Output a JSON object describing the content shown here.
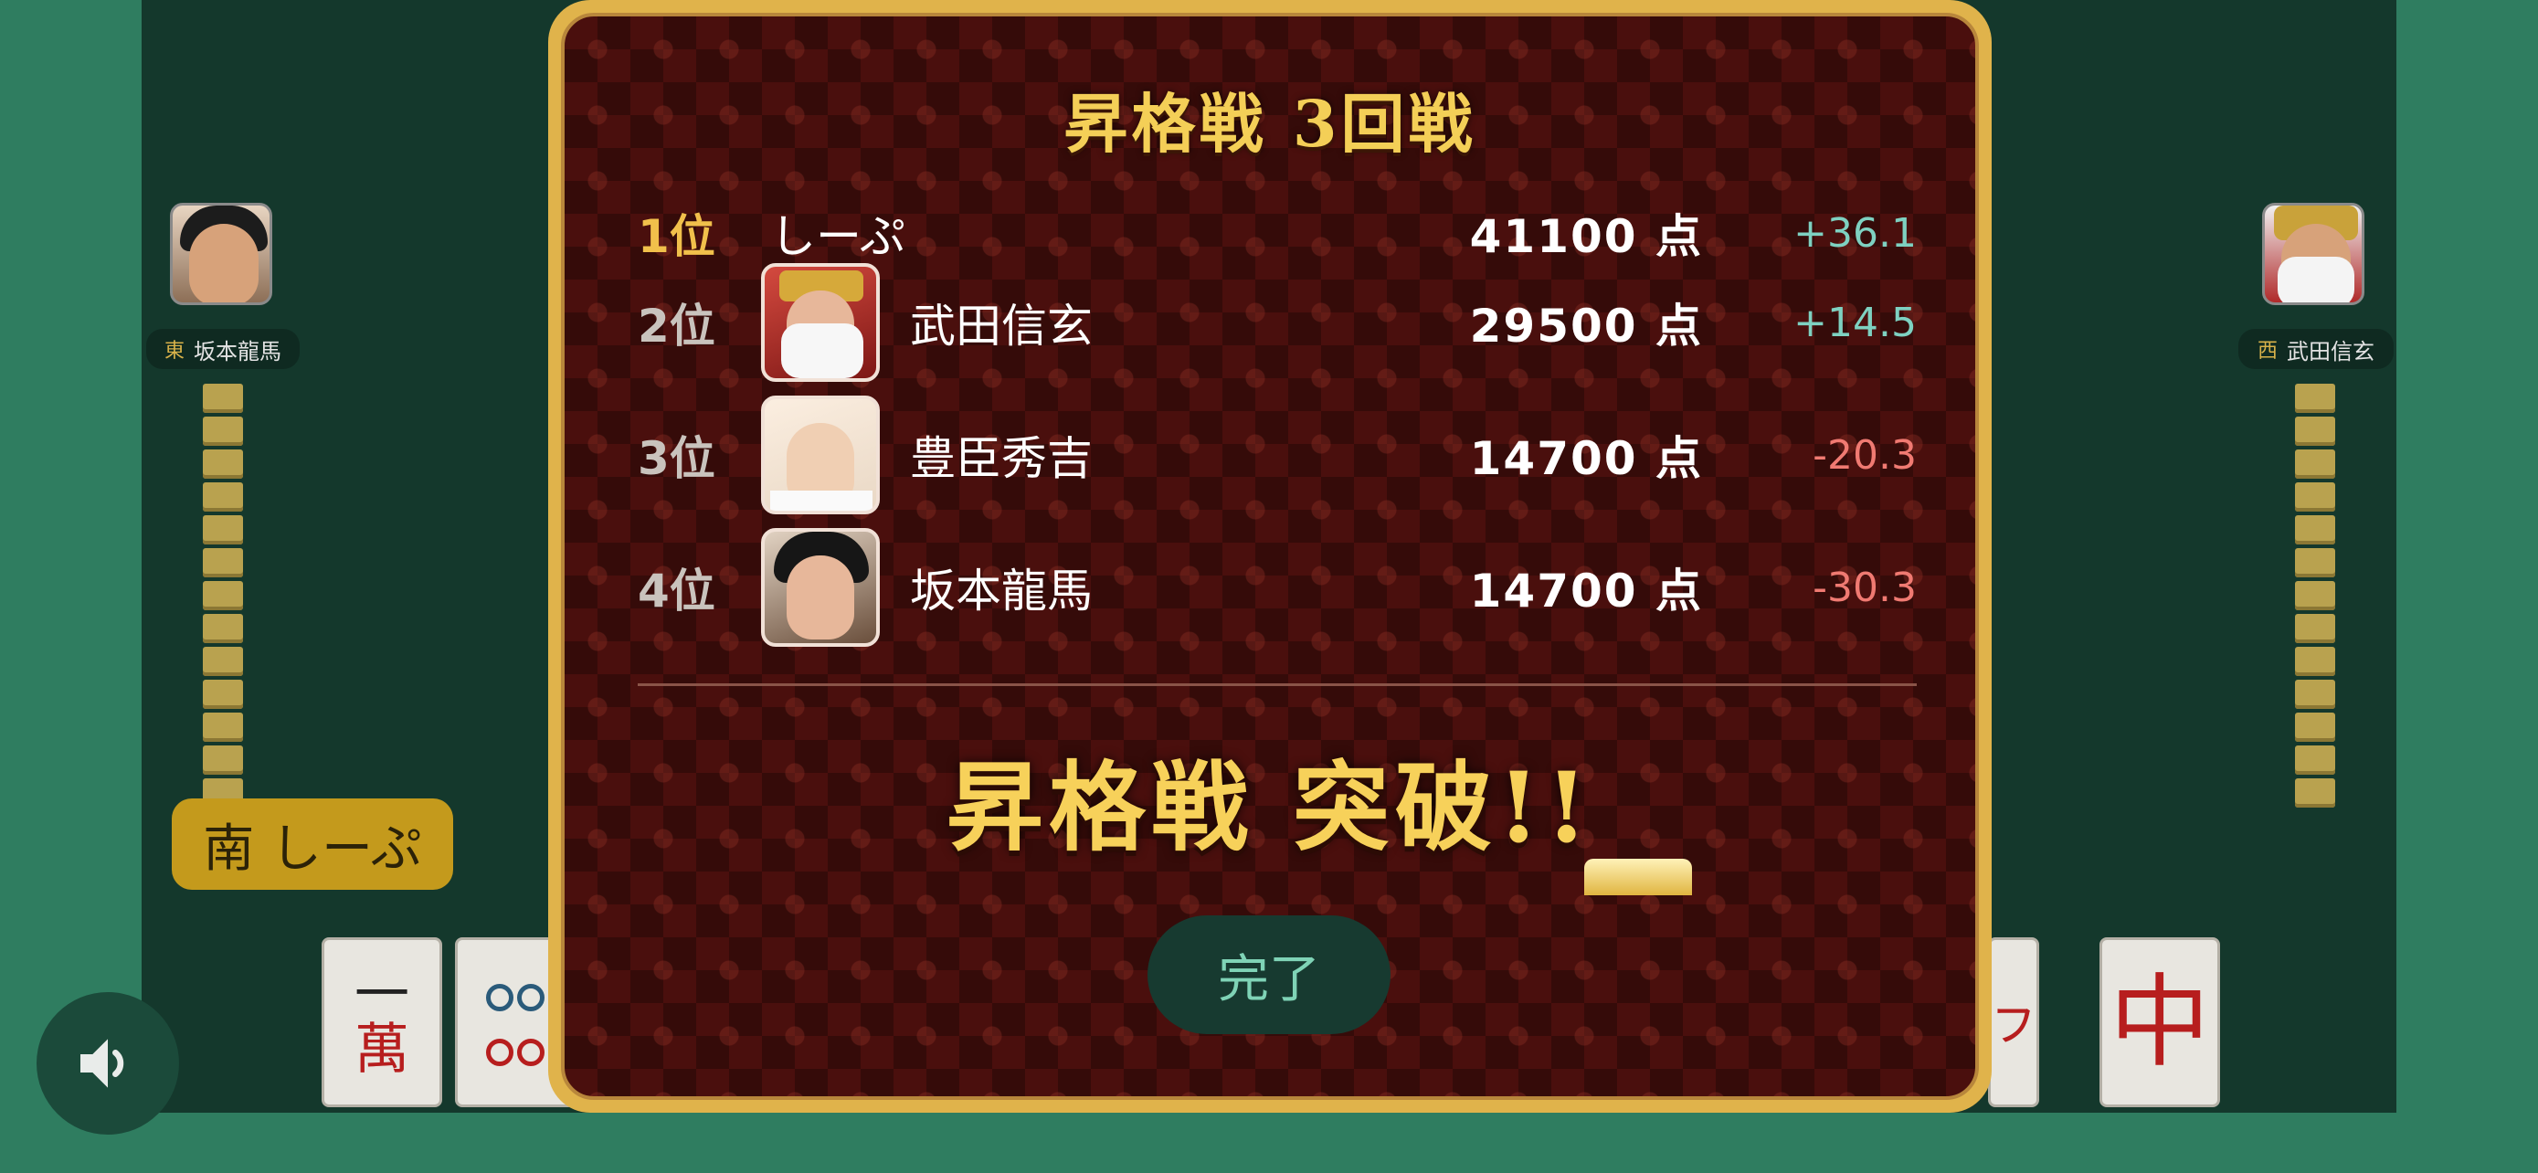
{
  "dialog": {
    "title": "昇格戦 3回戦",
    "result_banner": "昇格戦 突破!!",
    "done_button": "完了",
    "rankings": [
      {
        "rank": "1位",
        "name": "しーぷ",
        "score": "41100 点",
        "delta": "+36.1"
      },
      {
        "rank": "2位",
        "name": "武田信玄",
        "score": "29500 点",
        "delta": "+14.5"
      },
      {
        "rank": "3位",
        "name": "豊臣秀吉",
        "score": "14700 点",
        "delta": "-20.3"
      },
      {
        "rank": "4位",
        "name": "坂本龍馬",
        "score": "14700 点",
        "delta": "-30.3"
      }
    ]
  },
  "table": {
    "east_player": {
      "wind": "東",
      "name": "坂本龍馬"
    },
    "west_player": {
      "wind": "西",
      "name": "武田信玄"
    },
    "seat_label": "南 しーぷ",
    "hand_tiles": {
      "man1_top": "一",
      "man1_bottom": "萬",
      "red_dragon": "中",
      "partial": "ㇷ"
    }
  },
  "icons": {
    "sound": "speaker-icon"
  },
  "colors": {
    "table_green": "#2f7d60",
    "table_dark": "#14382c",
    "dialog_gold": "#e0b34b",
    "dialog_bg": "#4a0f0d",
    "title_gold": "#f4cf57",
    "positive": "#7ed1c1",
    "negative": "#f07a72"
  }
}
